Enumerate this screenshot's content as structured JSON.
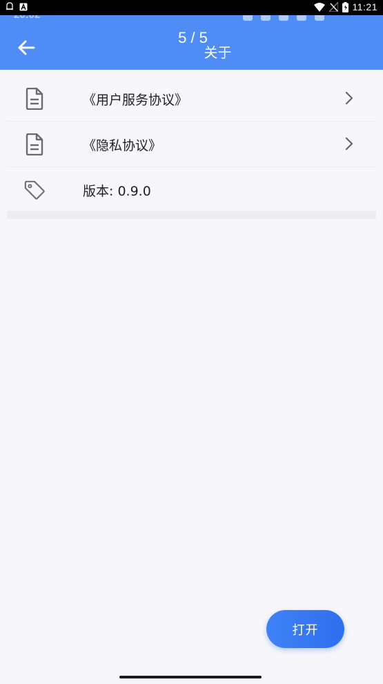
{
  "status_bar": {
    "time": "11:21",
    "left_icons": [
      "notification-icon",
      "app-a-icon"
    ],
    "right_icons": [
      "wifi-icon",
      "no-signal-icon",
      "battery-icon"
    ]
  },
  "app_bar": {
    "page_counter": "5 / 5",
    "title": "关于",
    "background_color": "#4f8cf5",
    "back_icon": "arrow-left-icon"
  },
  "list": {
    "items": [
      {
        "label": "《用户服务协议》",
        "icon": "document-icon",
        "has_chevron": true
      },
      {
        "label": "《隐私协议》",
        "icon": "document-icon",
        "has_chevron": true
      },
      {
        "label": "版本: 0.9.0",
        "icon": "tag-icon",
        "has_chevron": false
      }
    ]
  },
  "fab": {
    "label": "打开",
    "color": "#2f6ef0"
  }
}
